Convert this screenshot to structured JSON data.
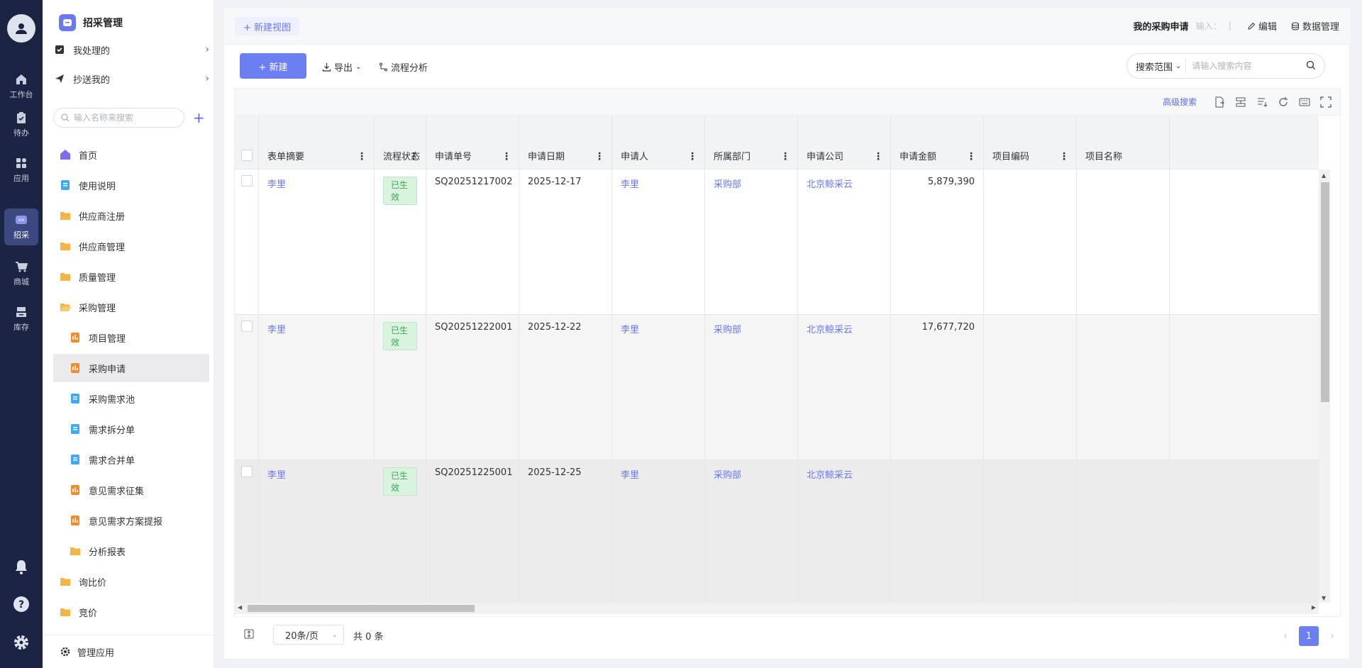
{
  "rail": {
    "items": [
      {
        "label": "工作台",
        "icon": "home-icon"
      },
      {
        "label": "待办",
        "icon": "clipboard-check-icon"
      },
      {
        "label": "应用",
        "icon": "apps-grid-icon"
      },
      {
        "label": "招采",
        "icon": "srm-icon",
        "badge": "SRM"
      },
      {
        "label": "商城",
        "icon": "cart-icon"
      },
      {
        "label": "库存",
        "icon": "warehouse-icon"
      }
    ]
  },
  "sidebar": {
    "app_name": "招采管理",
    "quick": [
      {
        "label": "我处理的"
      },
      {
        "label": "抄送我的"
      }
    ],
    "search_placeholder": "输入名称来搜索",
    "items": [
      {
        "label": "首页",
        "icon": "home-icon",
        "level": 0
      },
      {
        "label": "使用说明",
        "icon": "doc-icon",
        "level": 0
      },
      {
        "label": "供应商注册",
        "icon": "folder-icon",
        "level": 0
      },
      {
        "label": "供应商管理",
        "icon": "folder-icon",
        "level": 0
      },
      {
        "label": "质量管理",
        "icon": "folder-icon",
        "level": 0
      },
      {
        "label": "采购管理",
        "icon": "folder-open-icon",
        "level": 0
      },
      {
        "label": "项目管理",
        "icon": "table-icon",
        "level": 1
      },
      {
        "label": "采购申请",
        "icon": "table-icon",
        "level": 1,
        "selected": true
      },
      {
        "label": "采购需求池",
        "icon": "doc-icon",
        "level": 1
      },
      {
        "label": "需求拆分单",
        "icon": "doc-icon",
        "level": 1
      },
      {
        "label": "需求合并单",
        "icon": "doc-icon",
        "level": 1
      },
      {
        "label": "意见需求征集",
        "icon": "table-icon",
        "level": 1
      },
      {
        "label": "意见需求方案提报",
        "icon": "table-icon",
        "level": 1
      },
      {
        "label": "分析报表",
        "icon": "folder-icon",
        "level": 1
      },
      {
        "label": "询比价",
        "icon": "folder-icon",
        "level": 0
      },
      {
        "label": "竞价",
        "icon": "folder-icon",
        "level": 0
      }
    ],
    "footer": "管理应用"
  },
  "topbar": {
    "new_view": "+ 新建视图",
    "title": "我的采购申请",
    "input_hint": "输入：",
    "edit": "编辑",
    "data_manage": "数据管理"
  },
  "toolbar": {
    "new_btn": "+ 新建",
    "export": "导出",
    "flow_analysis": "流程分析",
    "search_scope": "搜索范围",
    "search_placeholder": "请输入搜索内容"
  },
  "table_tools": {
    "advanced_search": "高级搜索"
  },
  "table": {
    "columns": [
      "表单摘要",
      "流程状态",
      "申请单号",
      "申请日期",
      "申请人",
      "所属部门",
      "申请公司",
      "申请金额",
      "项目编码",
      "项目名称"
    ],
    "rows": [
      {
        "summary": "李里",
        "status": "已生效",
        "no": "SQ20251217002",
        "date": "2025-12-17",
        "applicant": "李里",
        "dept": "采购部",
        "company": "北京鲸采云",
        "amount": "5,879,390",
        "proj_code": "",
        "proj_name": ""
      },
      {
        "summary": "李里",
        "status": "已生效",
        "no": "SQ20251222001",
        "date": "2025-12-22",
        "applicant": "李里",
        "dept": "采购部",
        "company": "北京鲸采云",
        "amount": "17,677,720",
        "proj_code": "",
        "proj_name": ""
      },
      {
        "summary": "李里",
        "status": "已生效",
        "no": "SQ20251225001",
        "date": "2025-12-25",
        "applicant": "李里",
        "dept": "采购部",
        "company": "北京鲸采云",
        "amount": "",
        "proj_code": "",
        "proj_name": ""
      }
    ]
  },
  "pager": {
    "page_size": "20条/页",
    "total": "共 0 条",
    "current": "1"
  },
  "colors": {
    "rail_bg": "#1c2444",
    "accent": "#6b7ff2",
    "link": "#6b7be8",
    "status_green": "#3aa55a",
    "folder": "#f5b544",
    "doc": "#3fa9f5",
    "table_icon": "#f08c2e"
  }
}
